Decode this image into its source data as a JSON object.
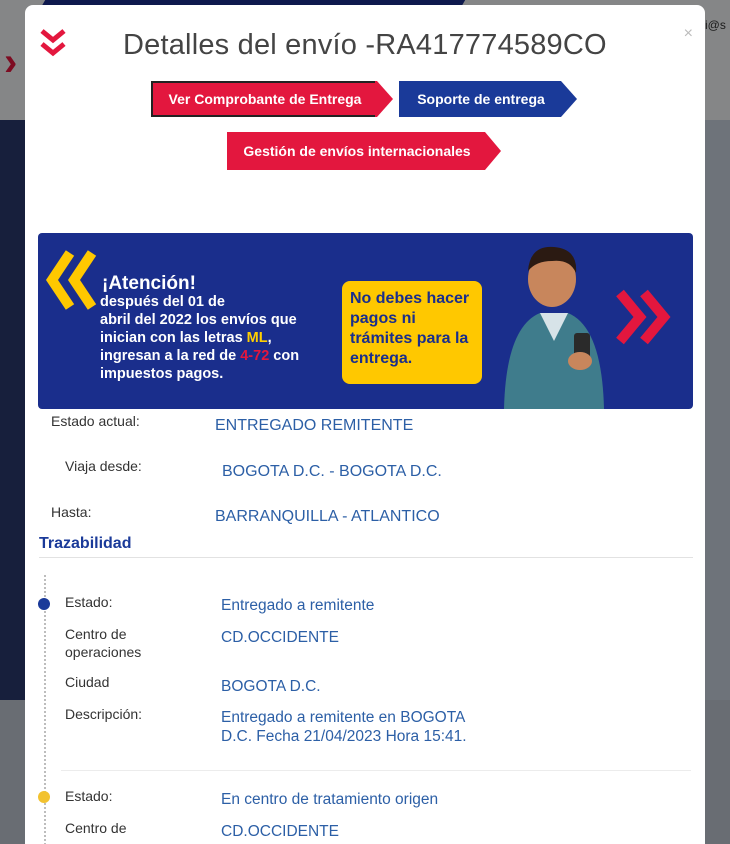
{
  "background": {
    "email_fragment": "i@s"
  },
  "modal": {
    "title": "Detalles del envío -RA417774589CO",
    "close_label": "×",
    "buttons": {
      "comprobante": "Ver Comprobante de Entrega",
      "soporte": "Soporte de entrega",
      "gestion": "Gestión de envíos internacionales"
    }
  },
  "banner": {
    "heading": "¡Atención!",
    "line1": "después del 01 de",
    "line2": "abril del 2022 los envíos que",
    "line3_prefix": "inician con las letras ",
    "line3_highlight": "ML",
    "line3_suffix": ",",
    "line4_prefix": "ingresan a la red de ",
    "line4_highlight": "4-72",
    "line4_suffix": " con",
    "line5": "impuestos pagos.",
    "box_text": "No debes hacer pagos ni trámites para la entrega."
  },
  "details": {
    "estado_label": "Estado actual:",
    "estado_value": "ENTREGADO REMITENTE",
    "desde_label": "Viaja desde:",
    "desde_value": "BOGOTA D.C. - BOGOTA D.C.",
    "hasta_label": "Hasta:",
    "hasta_value": "BARRANQUILLA - ATLANTICO"
  },
  "trazabilidad": {
    "title": "Trazabilidad",
    "events": [
      {
        "estado_label": "Estado:",
        "estado": "Entregado a remitente",
        "centro_label_1": "Centro de",
        "centro_label_2": "operaciones",
        "centro": "CD.OCCIDENTE",
        "ciudad_label": "Ciudad",
        "ciudad": "BOGOTA D.C.",
        "descripcion_label": "Descripción:",
        "descripcion": "Entregado a remitente en BOGOTA D.C. Fecha 21/04/2023 Hora 15:41."
      },
      {
        "estado_label": "Estado:",
        "estado": "En centro de tratamiento origen",
        "centro_label_1": "Centro de",
        "centro": "CD.OCCIDENTE"
      }
    ]
  },
  "colors": {
    "brand_red": "#e3173e",
    "brand_blue": "#1a3a99",
    "banner_blue": "#1a2e8c",
    "accent_yellow": "#ffc800",
    "link_blue": "#2c5fa6"
  }
}
